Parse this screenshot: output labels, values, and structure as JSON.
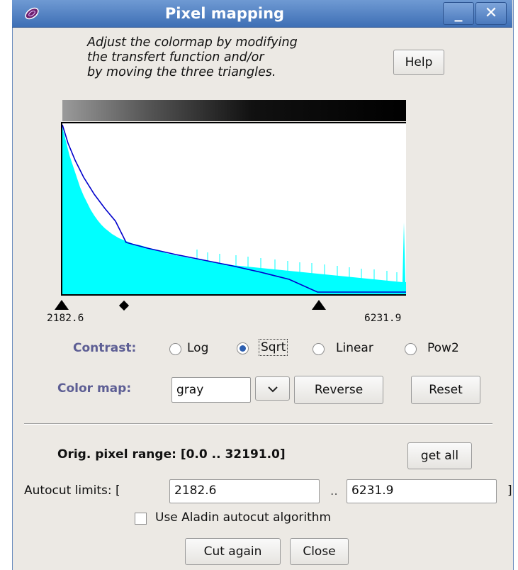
{
  "window": {
    "title": "Pixel mapping",
    "minimize_label": "_",
    "close_label": "✕"
  },
  "help": {
    "line1": "Adjust the colormap by modifying",
    "line2": "the transfert function and/or",
    "line3": "by moving the three triangles.",
    "button_label": "Help"
  },
  "histogram": {
    "min_label": "2182.6",
    "max_label": "6231.9",
    "fill_color": "#00ffff",
    "curve_color": "#0000cc",
    "background_color": "#ffffff",
    "colorbar": "gray-reversed"
  },
  "contrast": {
    "label": "Contrast:",
    "options": [
      {
        "label": "Log",
        "selected": false
      },
      {
        "label": "Sqrt",
        "selected": true
      },
      {
        "label": "Linear",
        "selected": false
      },
      {
        "label": "Pow2",
        "selected": false
      }
    ]
  },
  "colormap": {
    "label": "Color map:",
    "selected": "gray",
    "dropdown_icon": "chevron-down-icon",
    "reverse_label": "Reverse",
    "reset_label": "Reset"
  },
  "pixel_range": {
    "text": "Orig. pixel range: [0.0 .. 32191.0]",
    "get_all_label": "get all"
  },
  "autocut": {
    "label": "Autocut limits: [",
    "min_value": "2182.6",
    "separator": "..",
    "max_value": "6231.9",
    "closing_bracket": "]",
    "checkbox_label": "Use Aladin autocut algorithm",
    "checkbox_checked": false
  },
  "actions": {
    "cut_again_label": "Cut again",
    "close_label": "Close"
  },
  "colors": {
    "title_bar": "#4a7bc1",
    "label_accent": "#5d5e94",
    "window_bg": "#ece9e4"
  }
}
